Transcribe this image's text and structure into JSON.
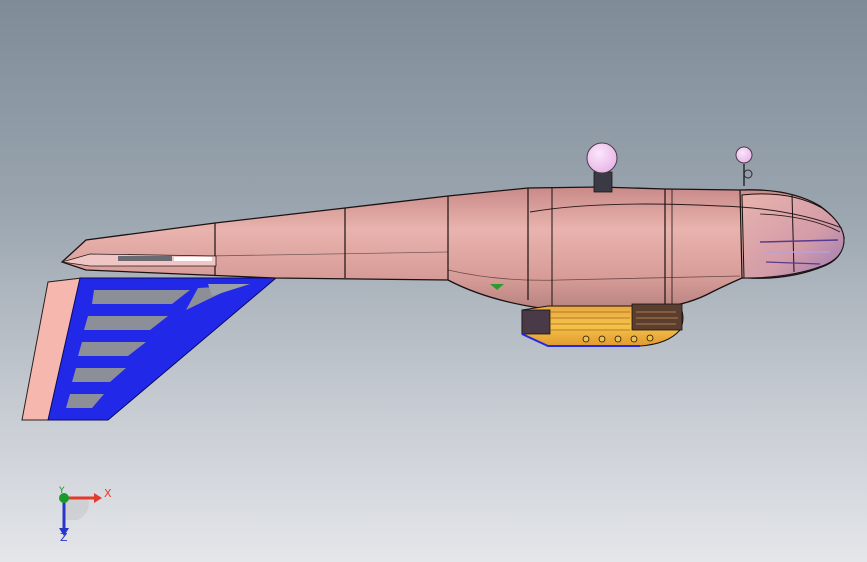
{
  "viewport": {
    "background_top": "#7f8c98",
    "background_bottom": "#e4e6ea"
  },
  "model": {
    "fuselage_color": "#e2a4a0",
    "fuselage_edge_color": "#1a1212",
    "strut_frame_color": "#2228e8",
    "strut_panel_color": "#f6b8ae",
    "pod_color": "#f0b040",
    "marker_color": "#f3cdf3"
  },
  "triad": {
    "x_label": "X",
    "y_label": "Y",
    "z_label": "Z",
    "x_color": "#e23b2e",
    "y_color": "#1a9a2a",
    "z_color": "#2a36c8"
  }
}
